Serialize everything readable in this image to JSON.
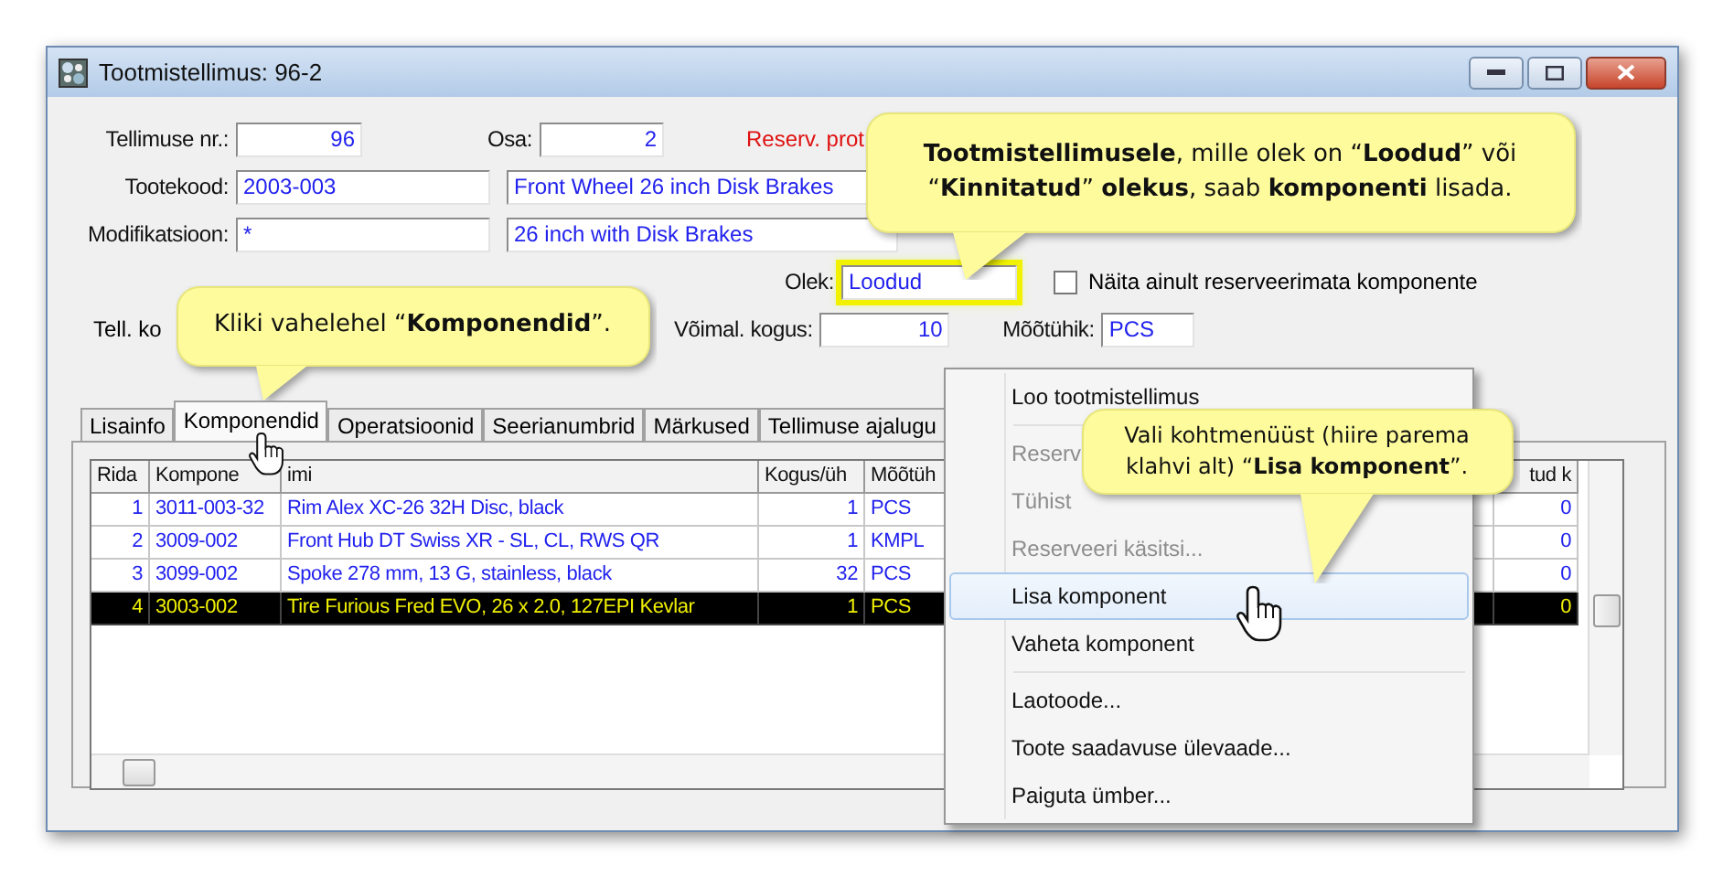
{
  "window": {
    "title": "Tootmistellimus: 96-2"
  },
  "order_no": {
    "label": "Tellimuse nr.:",
    "value": "96"
  },
  "part": {
    "label": "Osa:",
    "value": "2"
  },
  "reservation_note": "Reserv. prot",
  "product_code": {
    "label": "Tootekood:",
    "value": "2003-003",
    "description": "Front Wheel 26 inch Disk Brakes"
  },
  "modification": {
    "label": "Modifikatsioon:",
    "value": "*",
    "description": "26 inch with Disk Brakes"
  },
  "status": {
    "label": "Olek:",
    "value": "Loodud",
    "highlighted": true
  },
  "unreserved_only": {
    "label": "Näita ainult reserveerimata komponente",
    "checked": false
  },
  "order_qty": {
    "label": "Tell. ko"
  },
  "available_qty": {
    "label": "Võimal. kogus:",
    "value": "10"
  },
  "unit": {
    "label": "Mõõtühik:",
    "value": "PCS"
  },
  "tabs": [
    {
      "label": "Lisainfo",
      "selected": false
    },
    {
      "label": "Komponendid",
      "selected": true
    },
    {
      "label": "Operatsioonid",
      "selected": false
    },
    {
      "label": "Seerianumbrid",
      "selected": false
    },
    {
      "label": "Märkused",
      "selected": false
    },
    {
      "label": "Tellimuse ajalugu",
      "selected": false
    }
  ],
  "grid": {
    "columns": [
      "Rida",
      "Kompone",
      "imi",
      "Kogus/üh",
      "Mõõtüh",
      "tud k"
    ],
    "rows": [
      {
        "cells": [
          "1",
          "3011-003-32",
          "Rim Alex XC-26 32H Disc, black",
          "1",
          "PCS",
          "0"
        ],
        "selected": false
      },
      {
        "cells": [
          "2",
          "3009-002",
          "Front Hub DT Swiss XR - SL, CL, RWS QR",
          "1",
          "KMPL",
          "0"
        ],
        "selected": false
      },
      {
        "cells": [
          "3",
          "3099-002",
          "Spoke 278 mm, 13 G, stainless, black",
          "32",
          "PCS",
          "0"
        ],
        "selected": false
      },
      {
        "cells": [
          "4",
          "3003-002",
          "Tire Furious Fred EVO, 26 x 2.0, 127EPI Kevlar",
          "1",
          "PCS",
          "0"
        ],
        "selected": true
      }
    ]
  },
  "context_menu": {
    "items": [
      {
        "kind": "item",
        "label": "Loo tootmistellimus",
        "disabled": false,
        "selected": false
      },
      {
        "kind": "separator"
      },
      {
        "kind": "item",
        "label": "Reserv",
        "disabled": true,
        "selected": false
      },
      {
        "kind": "item",
        "label": "Tühist",
        "disabled": true,
        "selected": false
      },
      {
        "kind": "item",
        "label": "Reserveeri käsitsi...",
        "disabled": true,
        "selected": false
      },
      {
        "kind": "item",
        "label": "Lisa komponent",
        "disabled": false,
        "selected": true
      },
      {
        "kind": "item",
        "label": "Vaheta komponent",
        "disabled": false,
        "selected": false
      },
      {
        "kind": "separator"
      },
      {
        "kind": "item",
        "label": "Laotoode...",
        "disabled": false,
        "selected": false
      },
      {
        "kind": "item",
        "label": "Toote saadavuse ülevaade...",
        "disabled": false,
        "selected": false
      },
      {
        "kind": "item",
        "label": "Paiguta ümber...",
        "disabled": false,
        "selected": false
      }
    ]
  },
  "callouts": [
    {
      "text": "**Tootmistellimusele**, mille olek on “**Loodud**” või “**Kinnitatud**” **olekus**, saab **komponenti** lisada."
    },
    {
      "text": "Kliki vahelehel “**Komponendid**”."
    },
    {
      "text": "Vali kohtmenüüst (hiire parema klahvi alt) “**Lisa komponent**”."
    }
  ]
}
